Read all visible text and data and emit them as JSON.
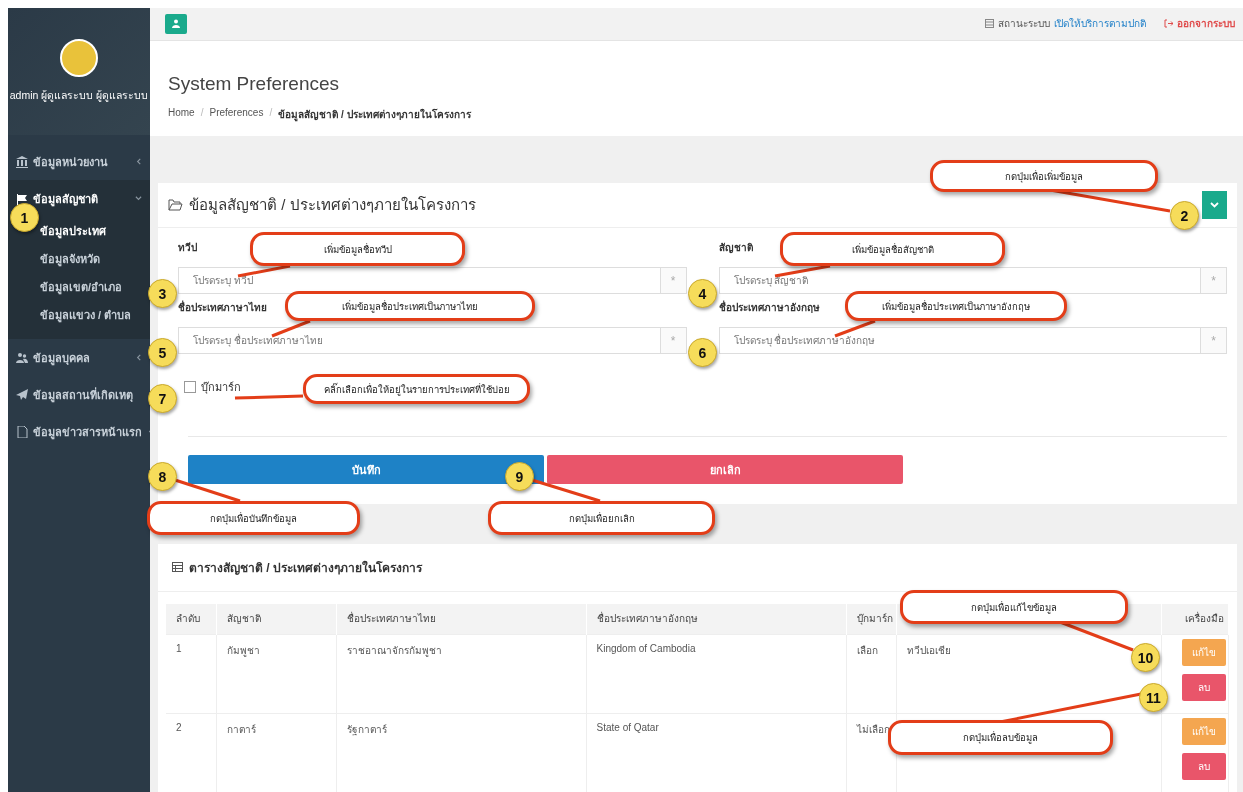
{
  "sidebar": {
    "user": "admin ผู้ดูแลระบบ ผู้ดูแลระบบ",
    "items": [
      {
        "label": "ข้อมูลหน่วยงาน",
        "expanded": false
      },
      {
        "label": "ข้อมูลสัญชาติ",
        "expanded": true,
        "children": [
          {
            "label": "ข้อมูลประเทศ",
            "selected": true
          },
          {
            "label": "ข้อมูลจังหวัด",
            "selected": false
          },
          {
            "label": "ข้อมูลเขต/อำเภอ",
            "selected": false
          },
          {
            "label": "ข้อมูลแขวง / ตำบล",
            "selected": false
          }
        ]
      },
      {
        "label": "ข้อมูลบุคคล",
        "expanded": false
      },
      {
        "label": "ข้อมูลสถานที่เกิดเหตุ"
      },
      {
        "label": "ข้อมูลข่าวสารหน้าแรก",
        "expanded": false
      }
    ]
  },
  "top_bar": {
    "status_label": "สถานะระบบ",
    "status_value": "เปิดให้บริการตามปกติ",
    "logout": "ออกจากระบบ"
  },
  "header": {
    "title": "System Preferences",
    "breadcrumb": [
      {
        "kind": "link",
        "label": "Home"
      },
      {
        "kind": "separator",
        "label": "/"
      },
      {
        "kind": "link",
        "label": "Preferences"
      },
      {
        "kind": "separator",
        "label": "/"
      },
      {
        "kind": "current",
        "label": "ข้อมูลสัญชาติ / ประเทศต่างๆภายในโครงการ"
      }
    ]
  },
  "form_panel": {
    "title": "ข้อมูลสัญชาติ / ประเทศต่างๆภายในโครงการ",
    "fields": [
      {
        "label": "ทวีป",
        "placeholder": "โปรดระบุ ทวีป",
        "addon": "*"
      },
      {
        "label": "สัญชาติ",
        "placeholder": "โปรดระบุ สัญชาติ",
        "addon": "*"
      },
      {
        "label": "ชื่อประเทศภาษาไทย",
        "placeholder": "โปรดระบุ ชื่อประเทศภาษาไทย",
        "addon": "*"
      },
      {
        "label": "ชื่อประเทศภาษาอังกฤษ",
        "placeholder": "โปรดระบุ ชื่อประเทศภาษาอังกฤษ",
        "addon": "*"
      }
    ],
    "bookmark": {
      "label": "บุ๊กมาร์ก",
      "checked": false
    },
    "buttons": [
      {
        "kind": "save",
        "label": "บันทึก"
      },
      {
        "kind": "cancel",
        "label": "ยกเลิก"
      }
    ]
  },
  "table_panel": {
    "title": "ตารางสัญชาติ / ประเทศต่างๆภายในโครงการ",
    "columns": [
      "ลำดับ",
      "สัญชาติ",
      "ชื่อประเทศภาษาไทย",
      "ชื่อประเทศภาษาอังกฤษ",
      "บุ๊กมาร์ก"
    ],
    "tools_column": "เครื่องมือ",
    "rows": [
      {
        "cells": [
          "1",
          "กัมพูชา",
          "ราชอาณาจักรกัมพูชา",
          "Kingdom of Cambodia",
          "เลือก"
        ],
        "column_6": "ทวีปเอเชีย",
        "actions": [
          {
            "kind": "edit",
            "label": "แก้ไข"
          },
          {
            "kind": "delete",
            "label": "ลบ"
          }
        ]
      },
      {
        "cells": [
          "2",
          "กาตาร์",
          "รัฐกาตาร์",
          "State of Qatar",
          "ไม่เลือก"
        ],
        "actions": [
          {
            "kind": "edit",
            "label": "แก้ไข"
          },
          {
            "kind": "delete",
            "label": "ลบ"
          }
        ]
      }
    ]
  },
  "callouts": [
    {
      "number": "1"
    },
    {
      "number": "2",
      "text": "กดปุ่มเพื่อเพิ่มข้อมูล"
    },
    {
      "number": "3",
      "text": "เพิ่มข้อมูลชื่อทวีป"
    },
    {
      "number": "4",
      "text": "เพิ่มข้อมูลชื่อสัญชาติ"
    },
    {
      "number": "5",
      "text": "เพิ่มข้อมูลชื่อประเทศเป็นภาษาไทย"
    },
    {
      "number": "6",
      "text": "เพิ่มข้อมูลชื่อประเทศเป็นภาษาอังกฤษ"
    },
    {
      "number": "7",
      "text": "คลิ๊กเลือกเพื่อให้อยู่ในรายการประเทศที่ใช้บ่อย"
    },
    {
      "number": "8",
      "text": "กดปุ่มเพื่อบันทึกข้อมูล"
    },
    {
      "number": "9",
      "text": "กดปุ่มเพื่อยกเลิก"
    },
    {
      "number": "10",
      "text": "กดปุ่มเพื่อแก้ไขข้อมูล"
    },
    {
      "number": "11",
      "text": "กดปุ่มเพื่อลบข้อมูล"
    }
  ]
}
